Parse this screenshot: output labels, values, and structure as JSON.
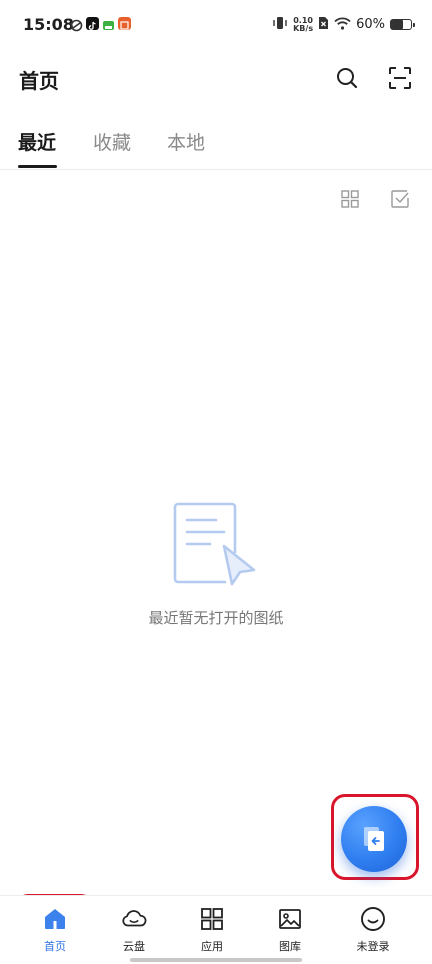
{
  "status_bar": {
    "time": "15:08",
    "net_speed_value": "0.10",
    "net_speed_unit": "KB/s",
    "battery_text": "60%",
    "battery_level": 0.6,
    "notification_icons": [
      "sync-icon",
      "tiktok-icon",
      "app-icon",
      "news-icon"
    ]
  },
  "header": {
    "title": "首页"
  },
  "tabs": [
    {
      "label": "最近",
      "active": true
    },
    {
      "label": "收藏",
      "active": false
    },
    {
      "label": "本地",
      "active": false
    }
  ],
  "empty_state": {
    "message": "最近暂无打开的图纸"
  },
  "bottom_nav": [
    {
      "label": "首页",
      "icon": "home-icon",
      "active": true
    },
    {
      "label": "云盘",
      "icon": "cloud-icon",
      "active": false
    },
    {
      "label": "应用",
      "icon": "apps-grid-icon",
      "active": false
    },
    {
      "label": "图库",
      "icon": "gallery-icon",
      "active": false
    },
    {
      "label": "未登录",
      "icon": "smile-icon",
      "active": false
    }
  ],
  "colors": {
    "accent": "#2f7ef0",
    "highlight_outline": "#d9152b",
    "active_nav_text": "#2f73e0"
  }
}
